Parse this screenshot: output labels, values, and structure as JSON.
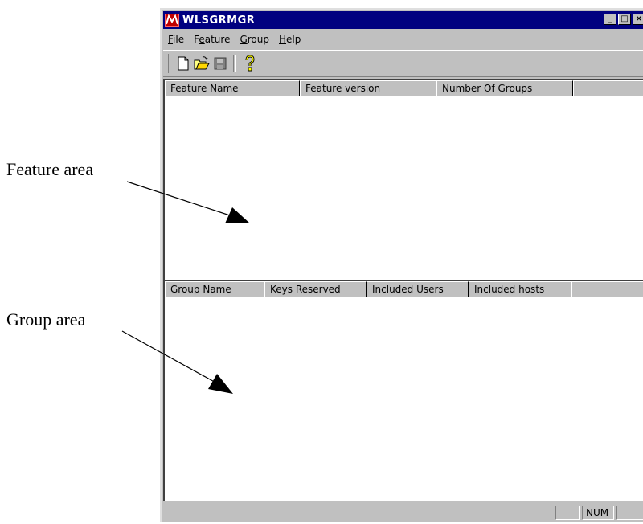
{
  "annotations": {
    "feature_area": "Feature area",
    "group_area": "Group area"
  },
  "window": {
    "title": "WLSGRMGR",
    "app_icon": "wlsgrmgr-app-icon",
    "title_buttons": {
      "minimize": "_",
      "maximize": "□",
      "close": "×"
    }
  },
  "menu": {
    "file": {
      "mnemonic": "F",
      "rest": "ile"
    },
    "feature": {
      "pre": "F",
      "mnemonic": "e",
      "rest": "ature"
    },
    "group": {
      "mnemonic": "G",
      "rest": "roup"
    },
    "help": {
      "mnemonic": "H",
      "rest": "elp"
    }
  },
  "toolbar": {
    "icons": [
      "new-document-icon",
      "open-folder-icon",
      "save-disk-icon",
      "context-help-icon"
    ]
  },
  "feature_table": {
    "columns": [
      "Feature Name",
      "Feature version",
      "Number Of Groups"
    ],
    "rows": []
  },
  "group_table": {
    "columns": [
      "Group Name",
      "Keys Reserved",
      "Included Users",
      "Included hosts"
    ],
    "rows": []
  },
  "statusbar": {
    "num_indicator": "NUM"
  },
  "colors": {
    "title_bar": "#000080",
    "face": "#c0c0c0",
    "list_background": "#ffffff"
  }
}
